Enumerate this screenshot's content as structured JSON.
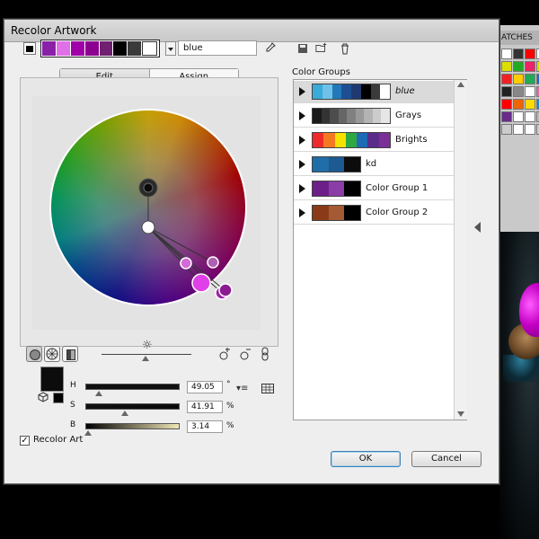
{
  "window": {
    "title": "Recolor Artwork"
  },
  "toolbar": {
    "active_swatch_color": "#000000",
    "strip_colors": [
      "#8a1fa8",
      "#e070e8",
      "#a000a8",
      "#8c0090",
      "#702070",
      "#000000",
      "#3a3a3a",
      "#ffffff"
    ],
    "group_name_value": "blue"
  },
  "tabs": {
    "edit_label": "Edit",
    "assign_label": "Assign"
  },
  "hsb": {
    "h_label": "H",
    "h_value": "49.05",
    "h_unit": "°",
    "h_level": 0.14,
    "s_label": "S",
    "s_value": "41.91",
    "s_unit": "%",
    "s_level": 0.42,
    "b_label": "B",
    "b_value": "3.14",
    "b_unit": "%",
    "b_level": 0.03
  },
  "footer": {
    "recolor_label": "Recolor Art",
    "recolor_checked": "✓",
    "ok_label": "OK",
    "cancel_label": "Cancel"
  },
  "color_groups": {
    "title": "Color Groups",
    "items": [
      {
        "name": "blue",
        "italic": true,
        "colors": [
          "#3aaad8",
          "#6ec2e8",
          "#2278b8",
          "#1e4f94",
          "#203a70",
          "#000000",
          "#3a3a3a",
          "#ffffff"
        ]
      },
      {
        "name": "Grays",
        "colors": [
          "#1a1a1a",
          "#333333",
          "#4d4d4d",
          "#666666",
          "#808080",
          "#999999",
          "#b3b3b3",
          "#cccccc",
          "#e6e6e6"
        ]
      },
      {
        "name": "Brights",
        "colors": [
          "#ee2b2b",
          "#f47920",
          "#f6e200",
          "#2ea843",
          "#1d6cb4",
          "#5a2d8a",
          "#7a3094"
        ]
      },
      {
        "name": "kd",
        "colors": [
          "#1f6ea8",
          "#1e5a92",
          "#0c0c0c"
        ]
      },
      {
        "name": "Color Group 1",
        "colors": [
          "#6c1f88",
          "#8b3da6",
          "#000000"
        ]
      },
      {
        "name": "Color Group 2",
        "colors": [
          "#8a3a18",
          "#a45a32",
          "#000000"
        ]
      }
    ]
  },
  "swatches_panel": {
    "tab_label": "ATCHES"
  }
}
